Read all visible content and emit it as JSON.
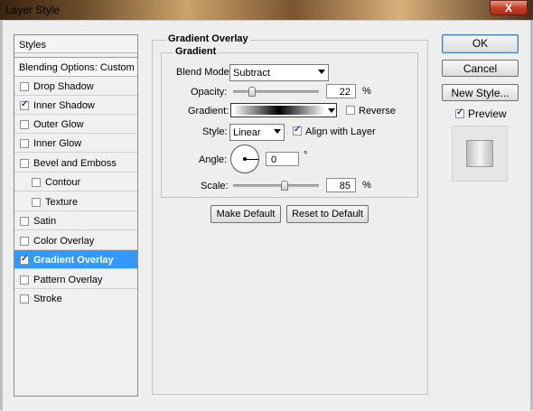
{
  "window": {
    "title": "Layer Style",
    "close_glyph": "X"
  },
  "sidebar": {
    "header": "Styles",
    "blending": "Blending Options: Custom",
    "items": [
      {
        "label": "Drop Shadow",
        "checked": false
      },
      {
        "label": "Inner Shadow",
        "checked": true
      },
      {
        "label": "Outer Glow",
        "checked": false
      },
      {
        "label": "Inner Glow",
        "checked": false
      },
      {
        "label": "Bevel and Emboss",
        "checked": false
      },
      {
        "label": "Contour",
        "checked": false
      },
      {
        "label": "Texture",
        "checked": false
      },
      {
        "label": "Satin",
        "checked": false
      },
      {
        "label": "Color Overlay",
        "checked": false
      },
      {
        "label": "Gradient Overlay",
        "checked": true
      },
      {
        "label": "Pattern Overlay",
        "checked": false
      },
      {
        "label": "Stroke",
        "checked": false
      }
    ]
  },
  "panel": {
    "group_title": "Gradient Overlay",
    "sub_title": "Gradient",
    "blend_mode_label": "Blend Mode:",
    "blend_mode_value": "Subtract",
    "opacity_label": "Opacity:",
    "opacity_value": "22",
    "opacity_fraction": 0.22,
    "percent": "%",
    "gradient_label": "Gradient:",
    "reverse_label": "Reverse",
    "reverse_checked": false,
    "style_label": "Style:",
    "style_value": "Linear",
    "align_label": "Align with Layer",
    "align_checked": true,
    "angle_label": "Angle:",
    "angle_value": "0",
    "degree": "°",
    "scale_label": "Scale:",
    "scale_value": "85",
    "scale_fraction": 0.6,
    "make_default": "Make Default",
    "reset_default": "Reset to Default"
  },
  "buttons": {
    "ok": "OK",
    "cancel": "Cancel",
    "new_style": "New Style...",
    "preview_label": "Preview",
    "preview_checked": true
  },
  "colors": {
    "selection": "#3399ff",
    "ok_border": "#3c7fb1"
  }
}
